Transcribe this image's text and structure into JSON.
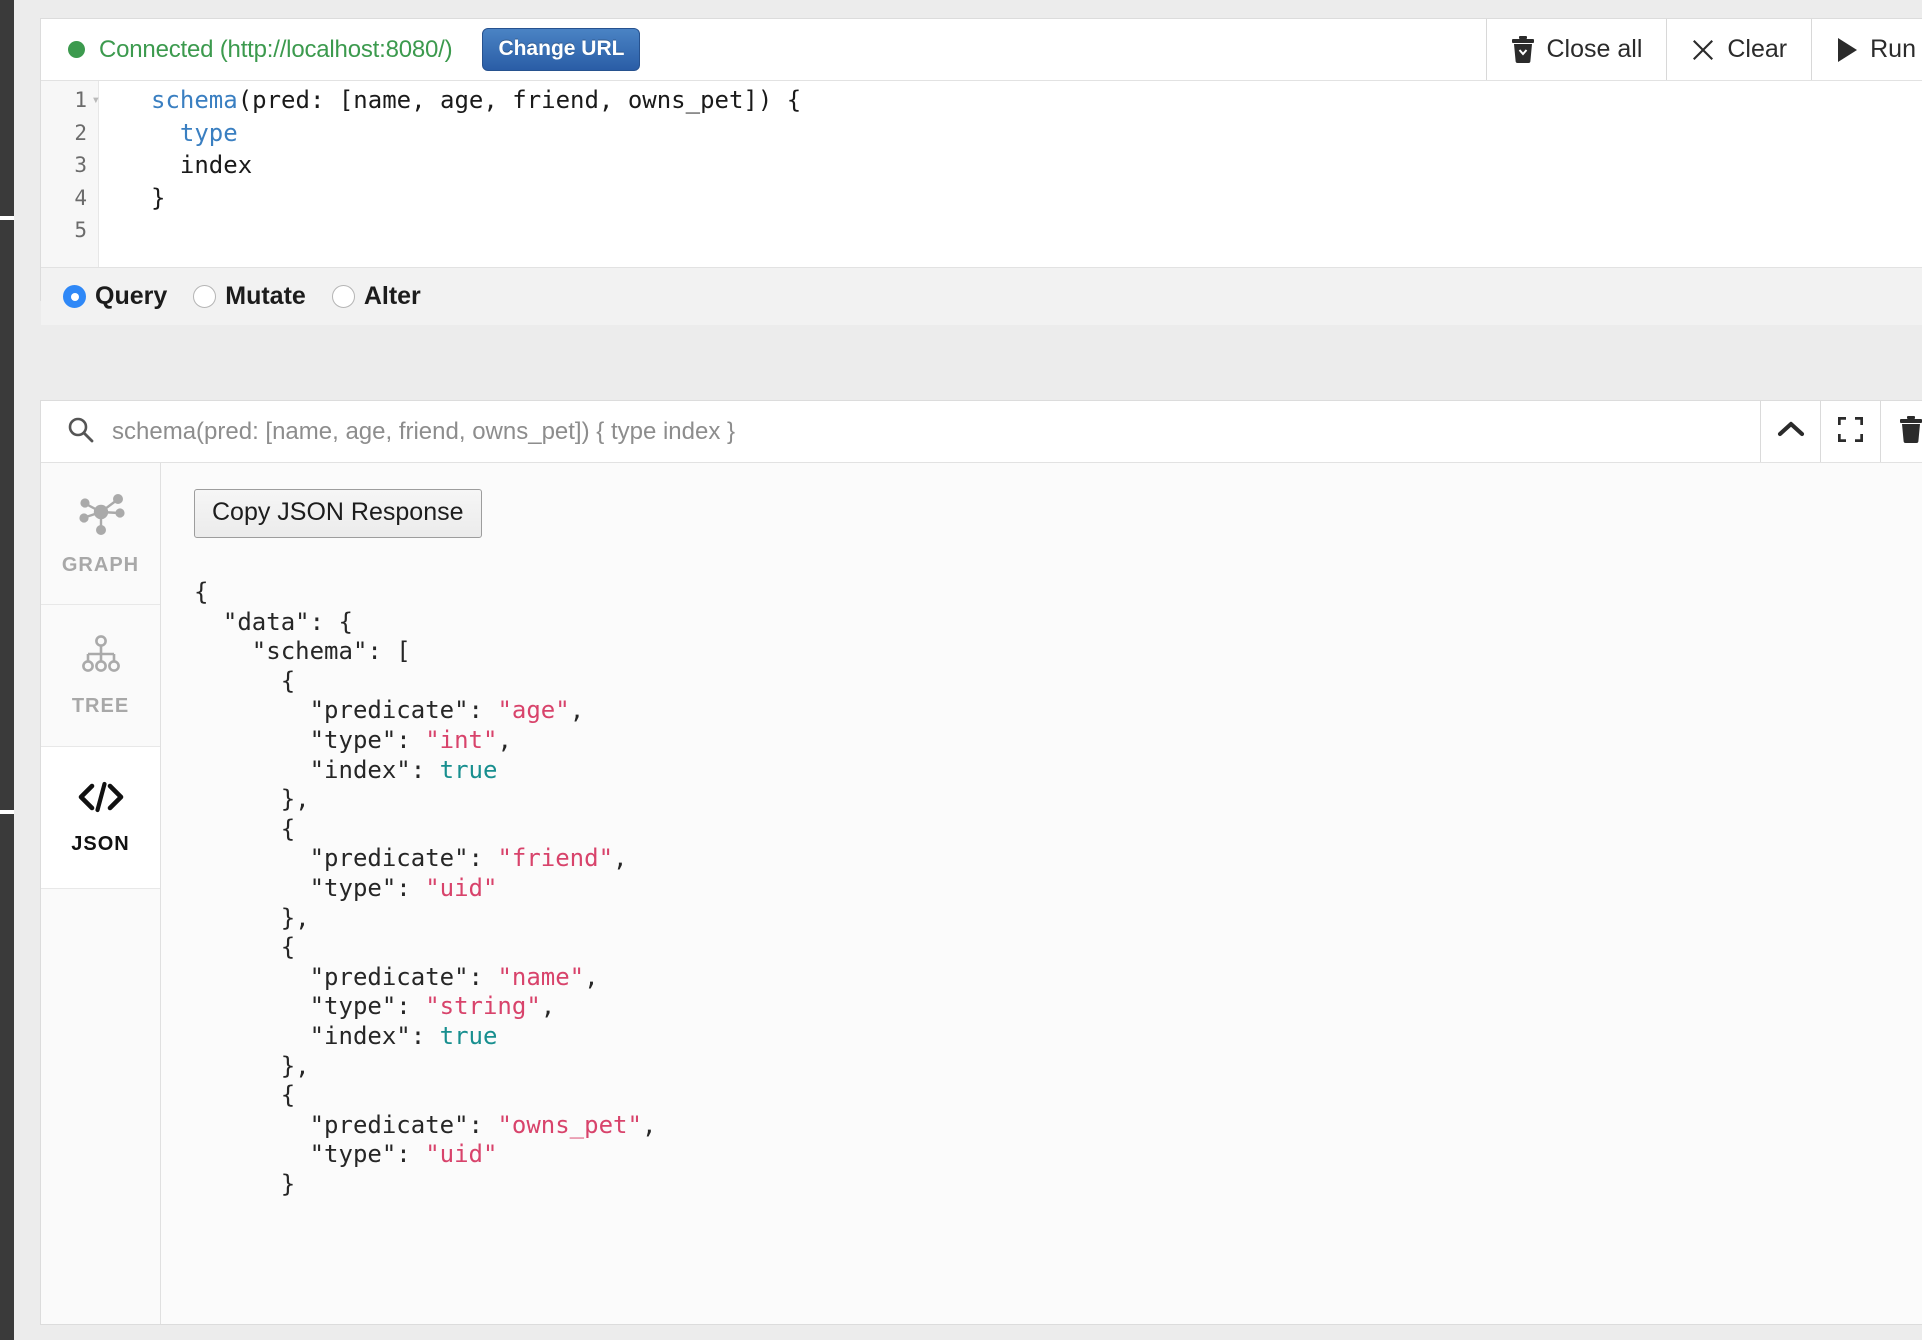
{
  "connection": {
    "status_label": "Connected (http://localhost:8080/)",
    "status_color": "#3c9a4e",
    "change_url_label": "Change URL"
  },
  "toolbar": {
    "close_all_label": "Close all",
    "clear_label": "Clear",
    "run_label": "Run"
  },
  "editor": {
    "lines": [
      {
        "number": "1",
        "foldable": true,
        "segments": [
          {
            "t": "schema",
            "c": "kw"
          },
          {
            "t": "(pred: [name, age, friend, owns_pet]) {",
            "c": ""
          }
        ]
      },
      {
        "number": "2",
        "foldable": false,
        "segments": [
          {
            "t": "  ",
            "c": ""
          },
          {
            "t": "type",
            "c": "kw"
          }
        ]
      },
      {
        "number": "3",
        "foldable": false,
        "segments": [
          {
            "t": "  index",
            "c": ""
          }
        ]
      },
      {
        "number": "4",
        "foldable": false,
        "segments": [
          {
            "t": "}",
            "c": ""
          }
        ]
      },
      {
        "number": "5",
        "foldable": false,
        "segments": [
          {
            "t": "",
            "c": ""
          }
        ]
      }
    ]
  },
  "mode": {
    "options": [
      {
        "label": "Query",
        "selected": true
      },
      {
        "label": "Mutate",
        "selected": false
      },
      {
        "label": "Alter",
        "selected": false
      }
    ]
  },
  "result": {
    "query_text": "schema(pred: [name, age, friend, owns_pet]) { type index }",
    "icons": [
      "chevron-up-icon",
      "fullscreen-icon",
      "trash-icon"
    ],
    "tabs": [
      {
        "label": "GRAPH",
        "icon": "graph-icon",
        "active": false
      },
      {
        "label": "TREE",
        "icon": "tree-icon",
        "active": false
      },
      {
        "label": "JSON",
        "icon": "code-icon",
        "active": true
      }
    ],
    "copy_button_label": "Copy JSON Response",
    "json_lines": [
      [
        {
          "t": "{",
          "c": ""
        }
      ],
      [
        {
          "t": "  \"data\": {",
          "c": ""
        }
      ],
      [
        {
          "t": "    \"schema\": [",
          "c": ""
        }
      ],
      [
        {
          "t": "      {",
          "c": ""
        }
      ],
      [
        {
          "t": "        \"predicate\": ",
          "c": ""
        },
        {
          "t": "\"age\"",
          "c": "j-str"
        },
        {
          "t": ",",
          "c": ""
        }
      ],
      [
        {
          "t": "        \"type\": ",
          "c": ""
        },
        {
          "t": "\"int\"",
          "c": "j-str"
        },
        {
          "t": ",",
          "c": ""
        }
      ],
      [
        {
          "t": "        \"index\": ",
          "c": ""
        },
        {
          "t": "true",
          "c": "j-bool"
        }
      ],
      [
        {
          "t": "      },",
          "c": ""
        }
      ],
      [
        {
          "t": "      {",
          "c": ""
        }
      ],
      [
        {
          "t": "        \"predicate\": ",
          "c": ""
        },
        {
          "t": "\"friend\"",
          "c": "j-str"
        },
        {
          "t": ",",
          "c": ""
        }
      ],
      [
        {
          "t": "        \"type\": ",
          "c": ""
        },
        {
          "t": "\"uid\"",
          "c": "j-str"
        }
      ],
      [
        {
          "t": "      },",
          "c": ""
        }
      ],
      [
        {
          "t": "      {",
          "c": ""
        }
      ],
      [
        {
          "t": "        \"predicate\": ",
          "c": ""
        },
        {
          "t": "\"name\"",
          "c": "j-str"
        },
        {
          "t": ",",
          "c": ""
        }
      ],
      [
        {
          "t": "        \"type\": ",
          "c": ""
        },
        {
          "t": "\"string\"",
          "c": "j-str"
        },
        {
          "t": ",",
          "c": ""
        }
      ],
      [
        {
          "t": "        \"index\": ",
          "c": ""
        },
        {
          "t": "true",
          "c": "j-bool"
        }
      ],
      [
        {
          "t": "      },",
          "c": ""
        }
      ],
      [
        {
          "t": "      {",
          "c": ""
        }
      ],
      [
        {
          "t": "        \"predicate\": ",
          "c": ""
        },
        {
          "t": "\"owns_pet\"",
          "c": "j-str"
        },
        {
          "t": ",",
          "c": ""
        }
      ],
      [
        {
          "t": "        \"type\": ",
          "c": ""
        },
        {
          "t": "\"uid\"",
          "c": "j-str"
        }
      ],
      [
        {
          "t": "      }",
          "c": ""
        }
      ]
    ]
  }
}
